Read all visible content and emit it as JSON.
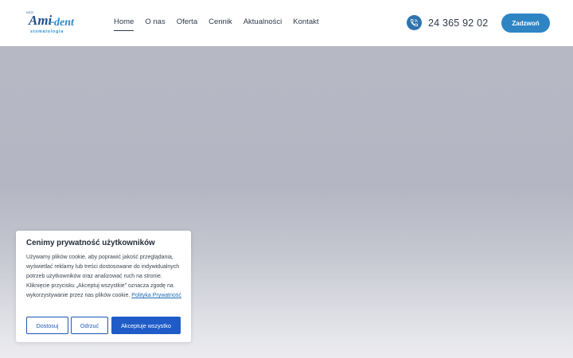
{
  "logo": {
    "small_text": "NZOZ",
    "name_part1": "Ami",
    "name_part2": "dent",
    "subtitle": "stomatologia"
  },
  "nav": {
    "items": [
      {
        "label": "Home",
        "active": true
      },
      {
        "label": "O nas"
      },
      {
        "label": "Oferta"
      },
      {
        "label": "Cennik"
      },
      {
        "label": "Aktualności"
      },
      {
        "label": "Kontakt"
      }
    ]
  },
  "contact": {
    "phone": "24 365 92 02",
    "phone_icon": "phone-icon",
    "call_button": "Zadzwoń"
  },
  "cookie": {
    "title": "Cenimy prywatność użytkowników",
    "text": "Używamy plików cookie, aby poprawić jakość przeglądania, wyświetlać reklamy lub treści dostosowane do indywidualnych potrzeb użytkowników oraz analizować ruch na stronie. Kliknięcie przycisku „Akceptuj wszystkie” oznacza zgodę na wykorzystywanie przez nas plików cookie.",
    "policy_link": "Polityka Prywatność",
    "customize_button": "Dostosuj",
    "reject_button": "Odrzuć",
    "accept_button": "Akceptuje wszystko"
  },
  "colors": {
    "accent": "#2f84c4",
    "cookie_primary": "#1f5cc8"
  }
}
